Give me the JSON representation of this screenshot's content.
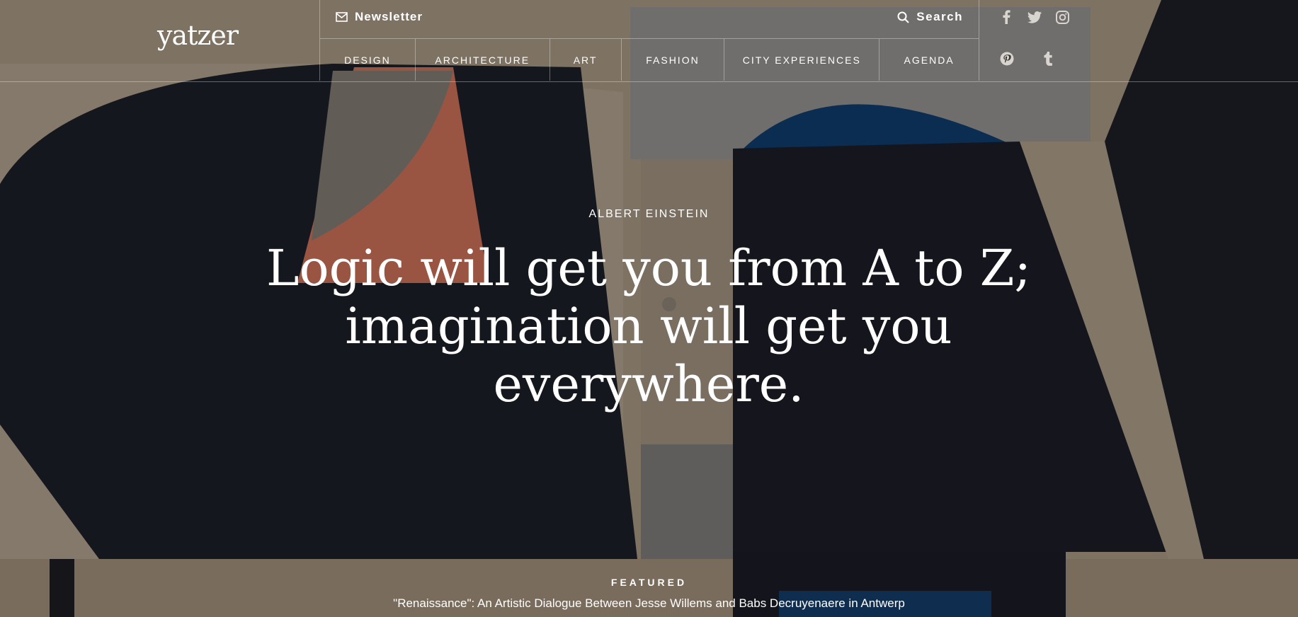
{
  "header": {
    "logo": "yatzer",
    "newsletter_label": "Newsletter",
    "search_label": "Search",
    "nav": [
      "DESIGN",
      "ARCHITECTURE",
      "ART",
      "FASHION",
      "CITY EXPERIENCES",
      "AGENDA"
    ],
    "social": [
      "facebook-icon",
      "twitter-icon",
      "instagram-icon",
      "pinterest-icon",
      "tumblr-icon"
    ]
  },
  "hero": {
    "author": "ALBERT EINSTEIN",
    "quote_line1": "Logic will get you from A to Z;",
    "quote_line2": "imagination will get you",
    "quote_line3": "everywhere."
  },
  "featured": {
    "label": "FEATURED",
    "title": "\"Renaissance\": An Artistic Dialogue Between Jesse Willems and Babs Decruyenaere in Antwerp"
  },
  "colors": {
    "paper": "#a89a86",
    "navy": "#1a1d28",
    "coral": "#c8705a",
    "blue": "#0f3d6e",
    "grey": "#8c8a88"
  }
}
